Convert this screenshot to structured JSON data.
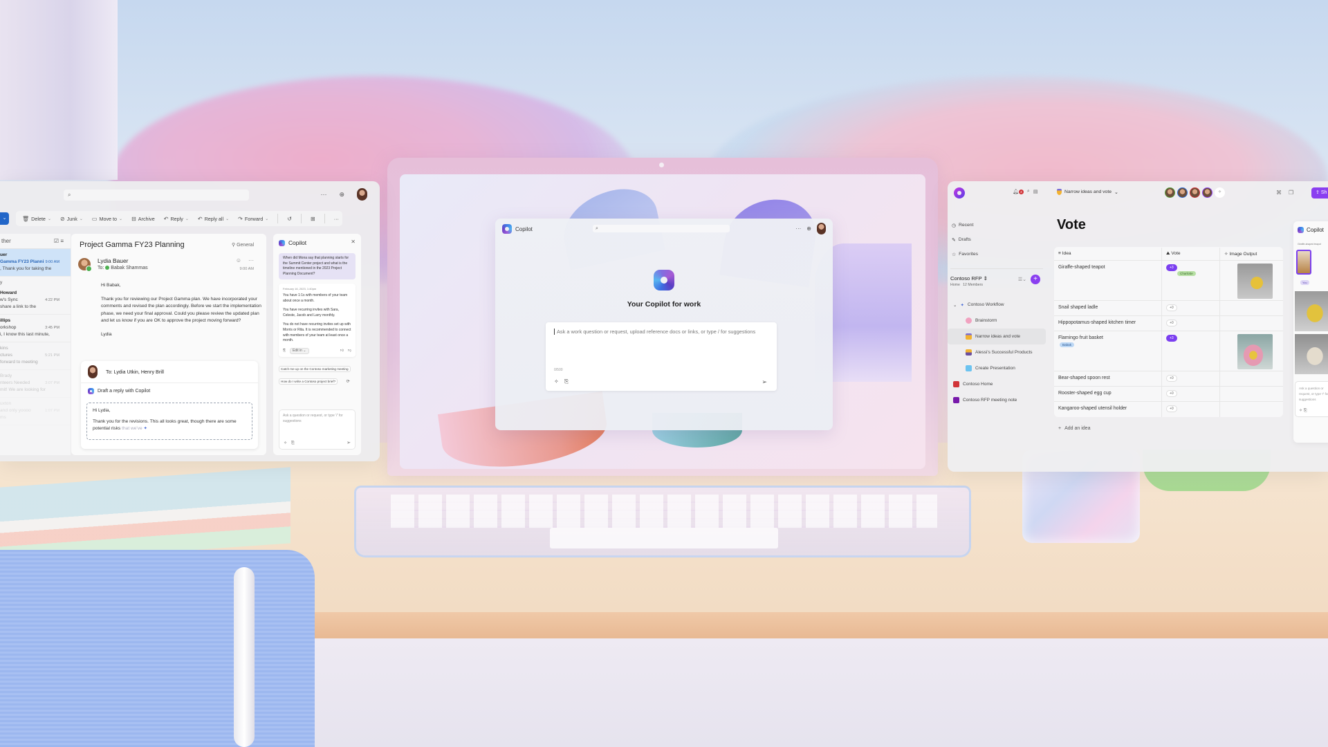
{
  "scene": {
    "colors": {
      "accent_blue": "#2266c8",
      "loop_purple": "#8a3ff0",
      "selected_mail_bg": "#cfe3f8"
    }
  },
  "center_copilot": {
    "app_name": "Copilot",
    "search_icon": "search-icon",
    "more_label": "···",
    "hero_title": "Your Copilot for work",
    "input_placeholder": "Ask a work question or request, upload reference docs or links, or type / for suggestions",
    "char_count": "0/500"
  },
  "outlook": {
    "more_label": "···",
    "toolbar": {
      "delete": "Delete",
      "junk": "Junk",
      "move_to": "Move to",
      "archive": "Archive",
      "reply": "Reply",
      "reply_all": "Reply all",
      "forward": "Forward",
      "more": "···"
    },
    "list": {
      "header": "ther",
      "items": [
        {
          "sender": "uer",
          "subject": "Gamma FY23 Planni",
          "time": "9:00 AM",
          "preview": ", Thank you for taking the",
          "selected": true
        },
        {
          "group": "y"
        },
        {
          "sender": "Howard",
          "subject": "w's Sync",
          "time": "4:22 PM",
          "preview": "share a link to the"
        },
        {
          "sender": "illips",
          "subject": "orkshop",
          "time": "3:45 PM",
          "preview": "i, I know this last minute,"
        },
        {
          "sender": "kins",
          "subject": "ctures",
          "time": "5:21 PM",
          "preview": "forward to meeting"
        },
        {
          "sender": "Brady",
          "subject": "nteers Needed",
          "time": "3:07 PM",
          "preview": "mit! We are looking for"
        },
        {
          "sender": "uxton",
          "subject": "and only yoooo",
          "time": "1:07 PM",
          "preview": "ms"
        }
      ]
    },
    "message": {
      "subject": "Project Gamma FY23 Planning",
      "tag": "General",
      "from": "Lydia Bauer",
      "to_prefix": "To:",
      "to": "Babak Shammas",
      "time": "9:00 AM",
      "greeting": "Hi Babak,",
      "body": "Thank you for reviewing our Project Gamma plan. We have incorporated your comments and revised the plan accordingly. Before we start the implementation phase, we need your final approval. Could you please review the updated plan and let us know if you are OK to approve the project moving forward?",
      "signoff": "Lydia"
    },
    "reply": {
      "to": "To: Lydia Utkin, Henry Brill",
      "draft_label": "Draft a reply with Copilot",
      "draft_greeting": "Hi Lydia,",
      "draft_text": "Thank you for the revisions. This all looks great, though there are some potential risks",
      "draft_ghost": "that we've"
    },
    "copilot": {
      "title": "Copilot",
      "question": "When did Mona say that planning starts for the Summit Center project and what is the timeline mentioned in the 2023 Project Planning Document?",
      "answer_date": "February 16, 2023, 1:40pm",
      "answer_p1": "You have 1:1s with members of your team about once a month.",
      "answer_p2": "You have recurring invites with Sara, Celeste, Jacob and Larry monthly.",
      "answer_p3": "You do not have recurring invites set up with Morris or Rita. It is recommended to connect with members of your team at least once a month.",
      "edit_label": "Edit in",
      "suggestions": [
        "Catch me up on the Contoso marketing meeting",
        "How do I write a Contoso project brief?"
      ],
      "input_placeholder": "Ask a question or request, or type '/' for suggestions"
    }
  },
  "loop": {
    "notification_count": "4",
    "nav": [
      {
        "icon": "clock-icon",
        "label": "Recent"
      },
      {
        "icon": "drafts-icon",
        "label": "Drafts"
      },
      {
        "icon": "star-icon",
        "label": "Favorites"
      }
    ],
    "workspace": {
      "name": "Contoso RFP",
      "home": "Home",
      "members": "12 Members"
    },
    "tree": [
      {
        "label": "Contoso Workflow",
        "level": 1
      },
      {
        "label": "Brainstorm",
        "level": 2
      },
      {
        "label": "Narrow ideas and vote",
        "level": 2,
        "active": true
      },
      {
        "label": "Alessi's Successful Products",
        "level": 2
      },
      {
        "label": "Create Presentation",
        "level": 2
      },
      {
        "label": "Contoso Home",
        "level": 1
      },
      {
        "label": "Contoso RFP meeting note",
        "level": 1
      }
    ],
    "breadcrumb": "Narrow ideas and vote",
    "share_label": "Sh",
    "page_title": "Vote",
    "table": {
      "headers": [
        "Idea",
        "Vote",
        "Image Output"
      ],
      "rows": [
        {
          "idea": "Giraffe-shaped teapot",
          "vote": "+3",
          "voted": true,
          "cursor": "Charlotte",
          "image": "giraffe-teapot-image"
        },
        {
          "idea": "Snail shaped ladle",
          "vote": "+0"
        },
        {
          "idea": "Hippopotamus-shaped kitchen timer",
          "vote": "+0"
        },
        {
          "idea": "Flamingo fruit basket",
          "vote": "+3",
          "voted": true,
          "cursor": "Babak",
          "image": "flamingo-basket-image"
        },
        {
          "idea": "Bear-shaped spoon rest",
          "vote": "+0"
        },
        {
          "idea": "Rooster-shaped egg cup",
          "vote": "+0"
        },
        {
          "idea": "Kangaroo-shaped utensil holder",
          "vote": "+0"
        }
      ]
    },
    "add_label": "Add an idea",
    "copilot": {
      "title": "Copilot",
      "prompt": "Giraffe-shaped teapot",
      "you_label": "You",
      "input_placeholder": "Ask a question or request, or type '/' for suggestions"
    }
  }
}
